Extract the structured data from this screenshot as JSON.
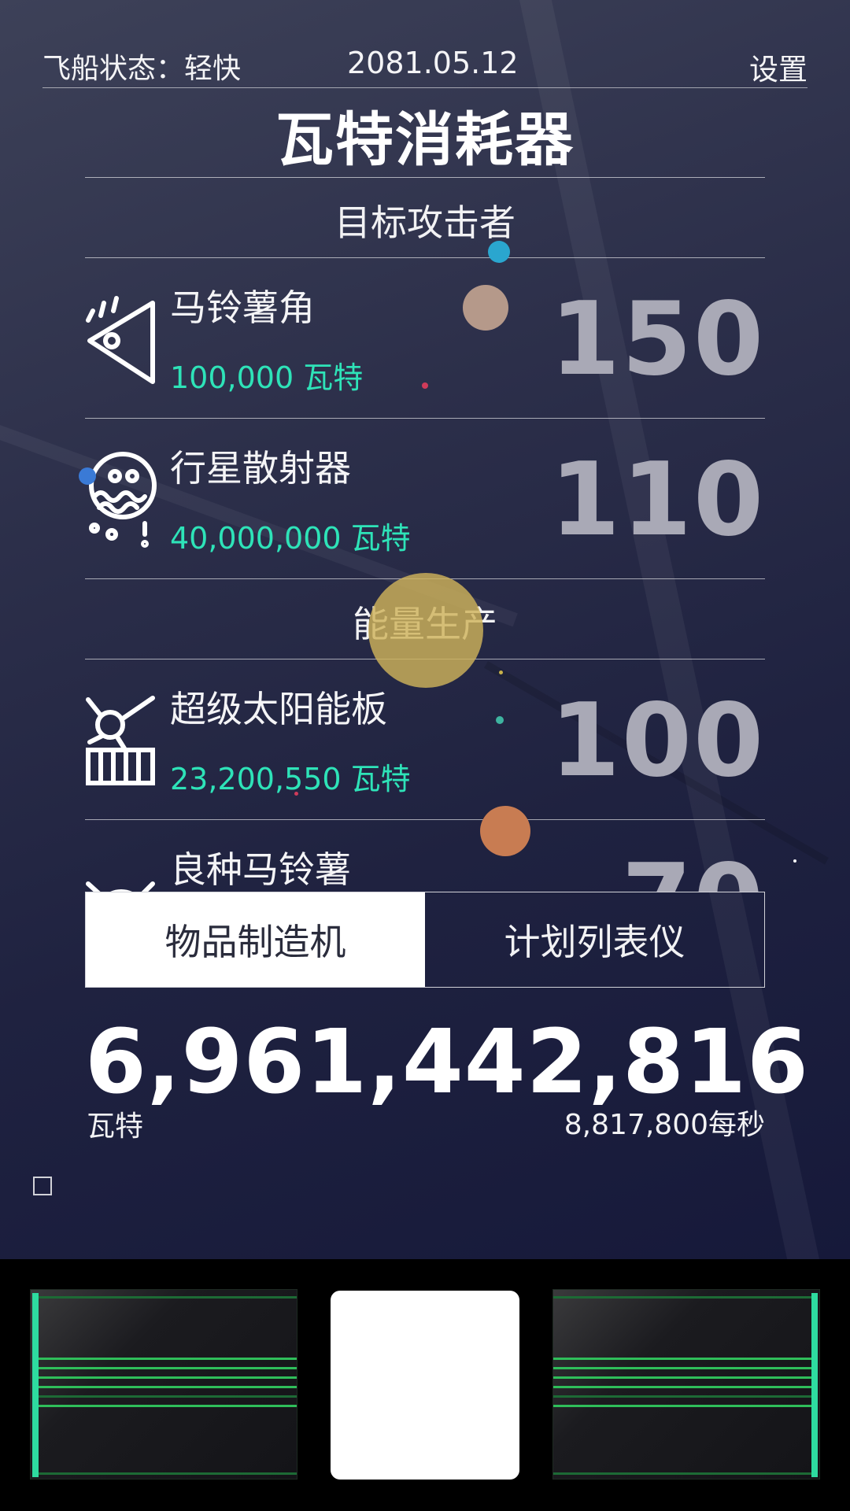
{
  "header": {
    "ship_status": "飞船状态：轻快",
    "date": "2081.05.12",
    "settings": "设置"
  },
  "title": "瓦特消耗器",
  "sections": [
    {
      "title": "目标攻击者",
      "items": [
        {
          "name": "马铃薯角",
          "cost": "100,000 瓦特",
          "count": "150",
          "icon": "potato-wedge-icon"
        },
        {
          "name": "行星散射器",
          "cost": "40,000,000 瓦特",
          "count": "110",
          "icon": "planet-scatterer-icon"
        }
      ]
    },
    {
      "title": "能量生产",
      "items": [
        {
          "name": "超级太阳能板",
          "cost": "23,200,550 瓦特",
          "count": "100",
          "icon": "solar-panel-icon"
        },
        {
          "name": "良种马铃薯",
          "cost": "",
          "count": "70",
          "icon": "seed-potato-icon"
        }
      ]
    }
  ],
  "tabs": {
    "left": "物品制造机",
    "right": "计划列表仪",
    "active": "left"
  },
  "total": {
    "value": "6,961,442,816",
    "unit": "瓦特",
    "rate": "8,817,800每秒"
  },
  "colors": {
    "accent": "#2ee3b8",
    "count": "#a9a9b6",
    "panel_bar": "#2edba0",
    "panel_stripe": "#2fbe5a"
  }
}
